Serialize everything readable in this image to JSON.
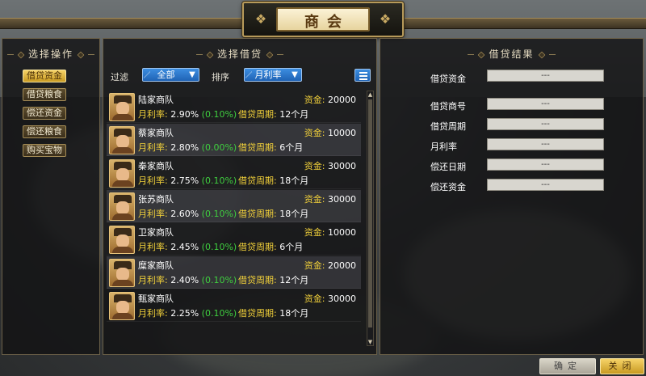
{
  "title": "商会",
  "left_panel": {
    "header": "选择操作",
    "actions": [
      {
        "label": "借贷资金",
        "active": true
      },
      {
        "label": "借贷粮食",
        "active": false
      },
      {
        "label": "偿还资金",
        "active": false
      },
      {
        "label": "偿还粮食",
        "active": false
      },
      {
        "label": "购买宝物",
        "active": false
      }
    ]
  },
  "middle_panel": {
    "header": "选择借贷",
    "filter_label": "过滤",
    "filter_value": "全部",
    "sort_label": "排序",
    "sort_value": "月利率",
    "fund_key": "资金:",
    "rate_key": "月利率:",
    "period_key": "借贷周期:",
    "lenders": [
      {
        "name": "陆家商队",
        "fund": "20000",
        "rate": "2.90%",
        "bonus": "(0.10%)",
        "period": "12个月"
      },
      {
        "name": "蔡家商队",
        "fund": "10000",
        "rate": "2.80%",
        "bonus": "(0.00%)",
        "period": "6个月"
      },
      {
        "name": "秦家商队",
        "fund": "30000",
        "rate": "2.75%",
        "bonus": "(0.10%)",
        "period": "18个月"
      },
      {
        "name": "张苏商队",
        "fund": "30000",
        "rate": "2.60%",
        "bonus": "(0.10%)",
        "period": "18个月"
      },
      {
        "name": "卫家商队",
        "fund": "10000",
        "rate": "2.45%",
        "bonus": "(0.10%)",
        "period": "6个月"
      },
      {
        "name": "糜家商队",
        "fund": "20000",
        "rate": "2.40%",
        "bonus": "(0.10%)",
        "period": "12个月"
      },
      {
        "name": "甄家商队",
        "fund": "30000",
        "rate": "2.25%",
        "bonus": "(0.10%)",
        "period": "18个月"
      }
    ]
  },
  "right_panel": {
    "header": "借贷结果",
    "fields": [
      {
        "label": "借贷资金",
        "value": "---"
      },
      {
        "label": "借贷商号",
        "value": "---"
      },
      {
        "label": "借贷周期",
        "value": "---"
      },
      {
        "label": "月利率",
        "value": "---"
      },
      {
        "label": "偿还日期",
        "value": "---"
      },
      {
        "label": "偿还资金",
        "value": "---"
      }
    ]
  },
  "buttons": {
    "confirm": "确定",
    "close": "关闭"
  },
  "colors": {
    "key_text": "#f2d13a",
    "bonus_text": "#3fcf3f",
    "active_button": "#f6d368",
    "select_blue": "#2a74cc"
  }
}
